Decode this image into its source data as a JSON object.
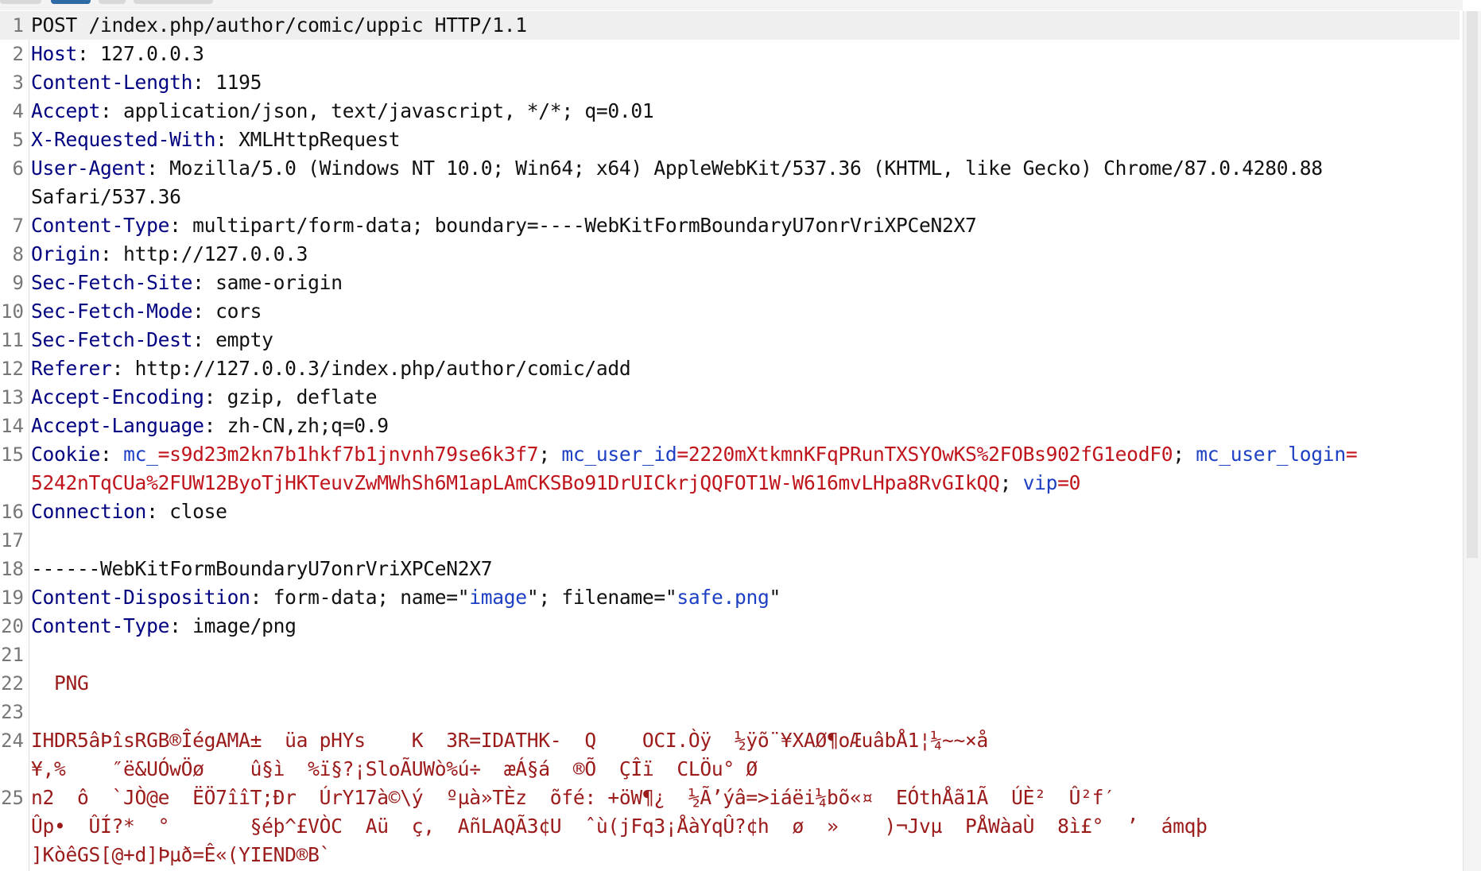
{
  "tabs": {
    "count": 4,
    "active_index": 1
  },
  "editor": {
    "lines": [
      {
        "n": "1",
        "highlight": true,
        "rows": [
          [
            [
              "v",
              "POST /index.php/author/comic/uppic HTTP/1.1"
            ]
          ]
        ]
      },
      {
        "n": "2",
        "rows": [
          [
            [
              "k",
              "Host"
            ],
            [
              "v",
              ": 127.0.0.3"
            ]
          ]
        ]
      },
      {
        "n": "3",
        "rows": [
          [
            [
              "k",
              "Content-Length"
            ],
            [
              "v",
              ": 1195"
            ]
          ]
        ]
      },
      {
        "n": "4",
        "rows": [
          [
            [
              "k",
              "Accept"
            ],
            [
              "v",
              ": application/json, text/javascript, */*; q=0.01"
            ]
          ]
        ]
      },
      {
        "n": "5",
        "rows": [
          [
            [
              "k",
              "X-Requested-With"
            ],
            [
              "v",
              ": XMLHttpRequest"
            ]
          ]
        ]
      },
      {
        "n": "6",
        "rows": [
          [
            [
              "k",
              "User-Agent"
            ],
            [
              "v",
              ": Mozilla/5.0 (Windows NT 10.0; Win64; x64) AppleWebKit/537.36 (KHTML, like Gecko) Chrome/87.0.4280.88"
            ]
          ],
          [
            [
              "v",
              "Safari/537.36"
            ]
          ]
        ]
      },
      {
        "n": "7",
        "rows": [
          [
            [
              "k",
              "Content-Type"
            ],
            [
              "v",
              ": multipart/form-data; boundary=----WebKitFormBoundaryU7onrVriXPCeN2X7"
            ]
          ]
        ]
      },
      {
        "n": "8",
        "rows": [
          [
            [
              "k",
              "Origin"
            ],
            [
              "v",
              ": http://127.0.0.3"
            ]
          ]
        ]
      },
      {
        "n": "9",
        "rows": [
          [
            [
              "k",
              "Sec-Fetch-Site"
            ],
            [
              "v",
              ": same-origin"
            ]
          ]
        ]
      },
      {
        "n": "10",
        "rows": [
          [
            [
              "k",
              "Sec-Fetch-Mode"
            ],
            [
              "v",
              ": cors"
            ]
          ]
        ]
      },
      {
        "n": "11",
        "rows": [
          [
            [
              "k",
              "Sec-Fetch-Dest"
            ],
            [
              "v",
              ": empty"
            ]
          ]
        ]
      },
      {
        "n": "12",
        "rows": [
          [
            [
              "k",
              "Referer"
            ],
            [
              "v",
              ": http://127.0.0.3/index.php/author/comic/add"
            ]
          ]
        ]
      },
      {
        "n": "13",
        "rows": [
          [
            [
              "k",
              "Accept-Encoding"
            ],
            [
              "v",
              ": gzip, deflate"
            ]
          ]
        ]
      },
      {
        "n": "14",
        "rows": [
          [
            [
              "k",
              "Accept-Language"
            ],
            [
              "v",
              ": zh-CN,zh;q=0.9"
            ]
          ]
        ]
      },
      {
        "n": "15",
        "rows": [
          [
            [
              "k",
              "Cookie"
            ],
            [
              "v",
              ": "
            ],
            [
              "b",
              "mc_"
            ],
            [
              "r",
              "=s9d23m2kn7b1hkf7b1jnvnh79se6k3f7"
            ],
            [
              "v",
              "; "
            ],
            [
              "b",
              "mc_user_id"
            ],
            [
              "r",
              "=2220mXtkmnKFqPRunTXSYOwKS%2FOBs902fG1eodF0"
            ],
            [
              "v",
              "; "
            ],
            [
              "b",
              "mc_user_login"
            ],
            [
              "r",
              "="
            ]
          ],
          [
            [
              "r",
              "5242nTqCUa%2FUW12ByoTjHKTeuvZwMWhSh6M1apLAmCKSBo91DrUICkrjQQFOT1W-W616mvLHpa8RvGIkQQ"
            ],
            [
              "v",
              "; "
            ],
            [
              "b",
              "vip"
            ],
            [
              "r",
              "=0"
            ]
          ]
        ]
      },
      {
        "n": "16",
        "rows": [
          [
            [
              "k",
              "Connection"
            ],
            [
              "v",
              ": close"
            ]
          ]
        ]
      },
      {
        "n": "17",
        "rows": [
          [
            [
              "v",
              ""
            ]
          ]
        ]
      },
      {
        "n": "18",
        "rows": [
          [
            [
              "v",
              "------WebKitFormBoundaryU7onrVriXPCeN2X7"
            ]
          ]
        ]
      },
      {
        "n": "19",
        "rows": [
          [
            [
              "k",
              "Content-Disposition"
            ],
            [
              "v",
              ": form-data; name=\""
            ],
            [
              "b",
              "image"
            ],
            [
              "v",
              "\"; filename=\""
            ],
            [
              "b",
              "safe.png"
            ],
            [
              "v",
              "\""
            ]
          ]
        ]
      },
      {
        "n": "20",
        "rows": [
          [
            [
              "k",
              "Content-Type"
            ],
            [
              "v",
              ": image/png"
            ]
          ]
        ]
      },
      {
        "n": "21",
        "rows": [
          [
            [
              "v",
              ""
            ]
          ]
        ]
      },
      {
        "n": "22",
        "rows": [
          [
            [
              "bin",
              "  PNG"
            ]
          ]
        ]
      },
      {
        "n": "23",
        "rows": [
          [
            [
              "v",
              ""
            ]
          ]
        ]
      },
      {
        "n": "24",
        "rows": [
          [
            [
              "bin",
              "IHDR5âÞîsRGB®ÎégAMA±  üa pHYs    K  3R=IDATHK-  Q    OCI.Òÿ  ½ÿõ¨¥XAØ¶oÆuâbÅ1¦¼~~×å"
            ]
          ],
          [
            [
              "bin",
              "¥,%    ″ë&UÓwÖø    û§ì  %ï§?¡SloÃUWò%ú÷  æÁ§á  ®Õ  ÇÎï  CLÖu° Ø"
            ]
          ]
        ]
      },
      {
        "n": "25",
        "rows": [
          [
            [
              "bin",
              "n2  ô  `JÒ@e  ËÖ7îîT;Ðr  ÚrY17à©\\ý  ºµà»TÈz  õfé: +öW¶¿  ½Ã’ýâ=>iáëi¼bõ«¤  EÓthÅã1Ã  ÚÈ²  Û²f′"
            ]
          ],
          [
            [
              "bin",
              "Ûp•  ÛÍ?*  °       §éþ^£VÒC  Aü  ç,  AñLAQÃ3¢U  ˆù(jFq3¡ÅàYqÛ?¢h  ø  »    )¬Jvµ  PÅWàaÙ  8ì£°  ’  ámqþ"
            ]
          ],
          [
            [
              "bin",
              "]KòêGS[@+d]Þµð=Ê«(YIEND®B`"
            ]
          ]
        ]
      }
    ]
  },
  "colors": {
    "header_key": "#000080",
    "cookie_name": "#1d3fc4",
    "cookie_value": "#c0141c",
    "binary": "#9b1a1a",
    "line_number": "#777777"
  }
}
